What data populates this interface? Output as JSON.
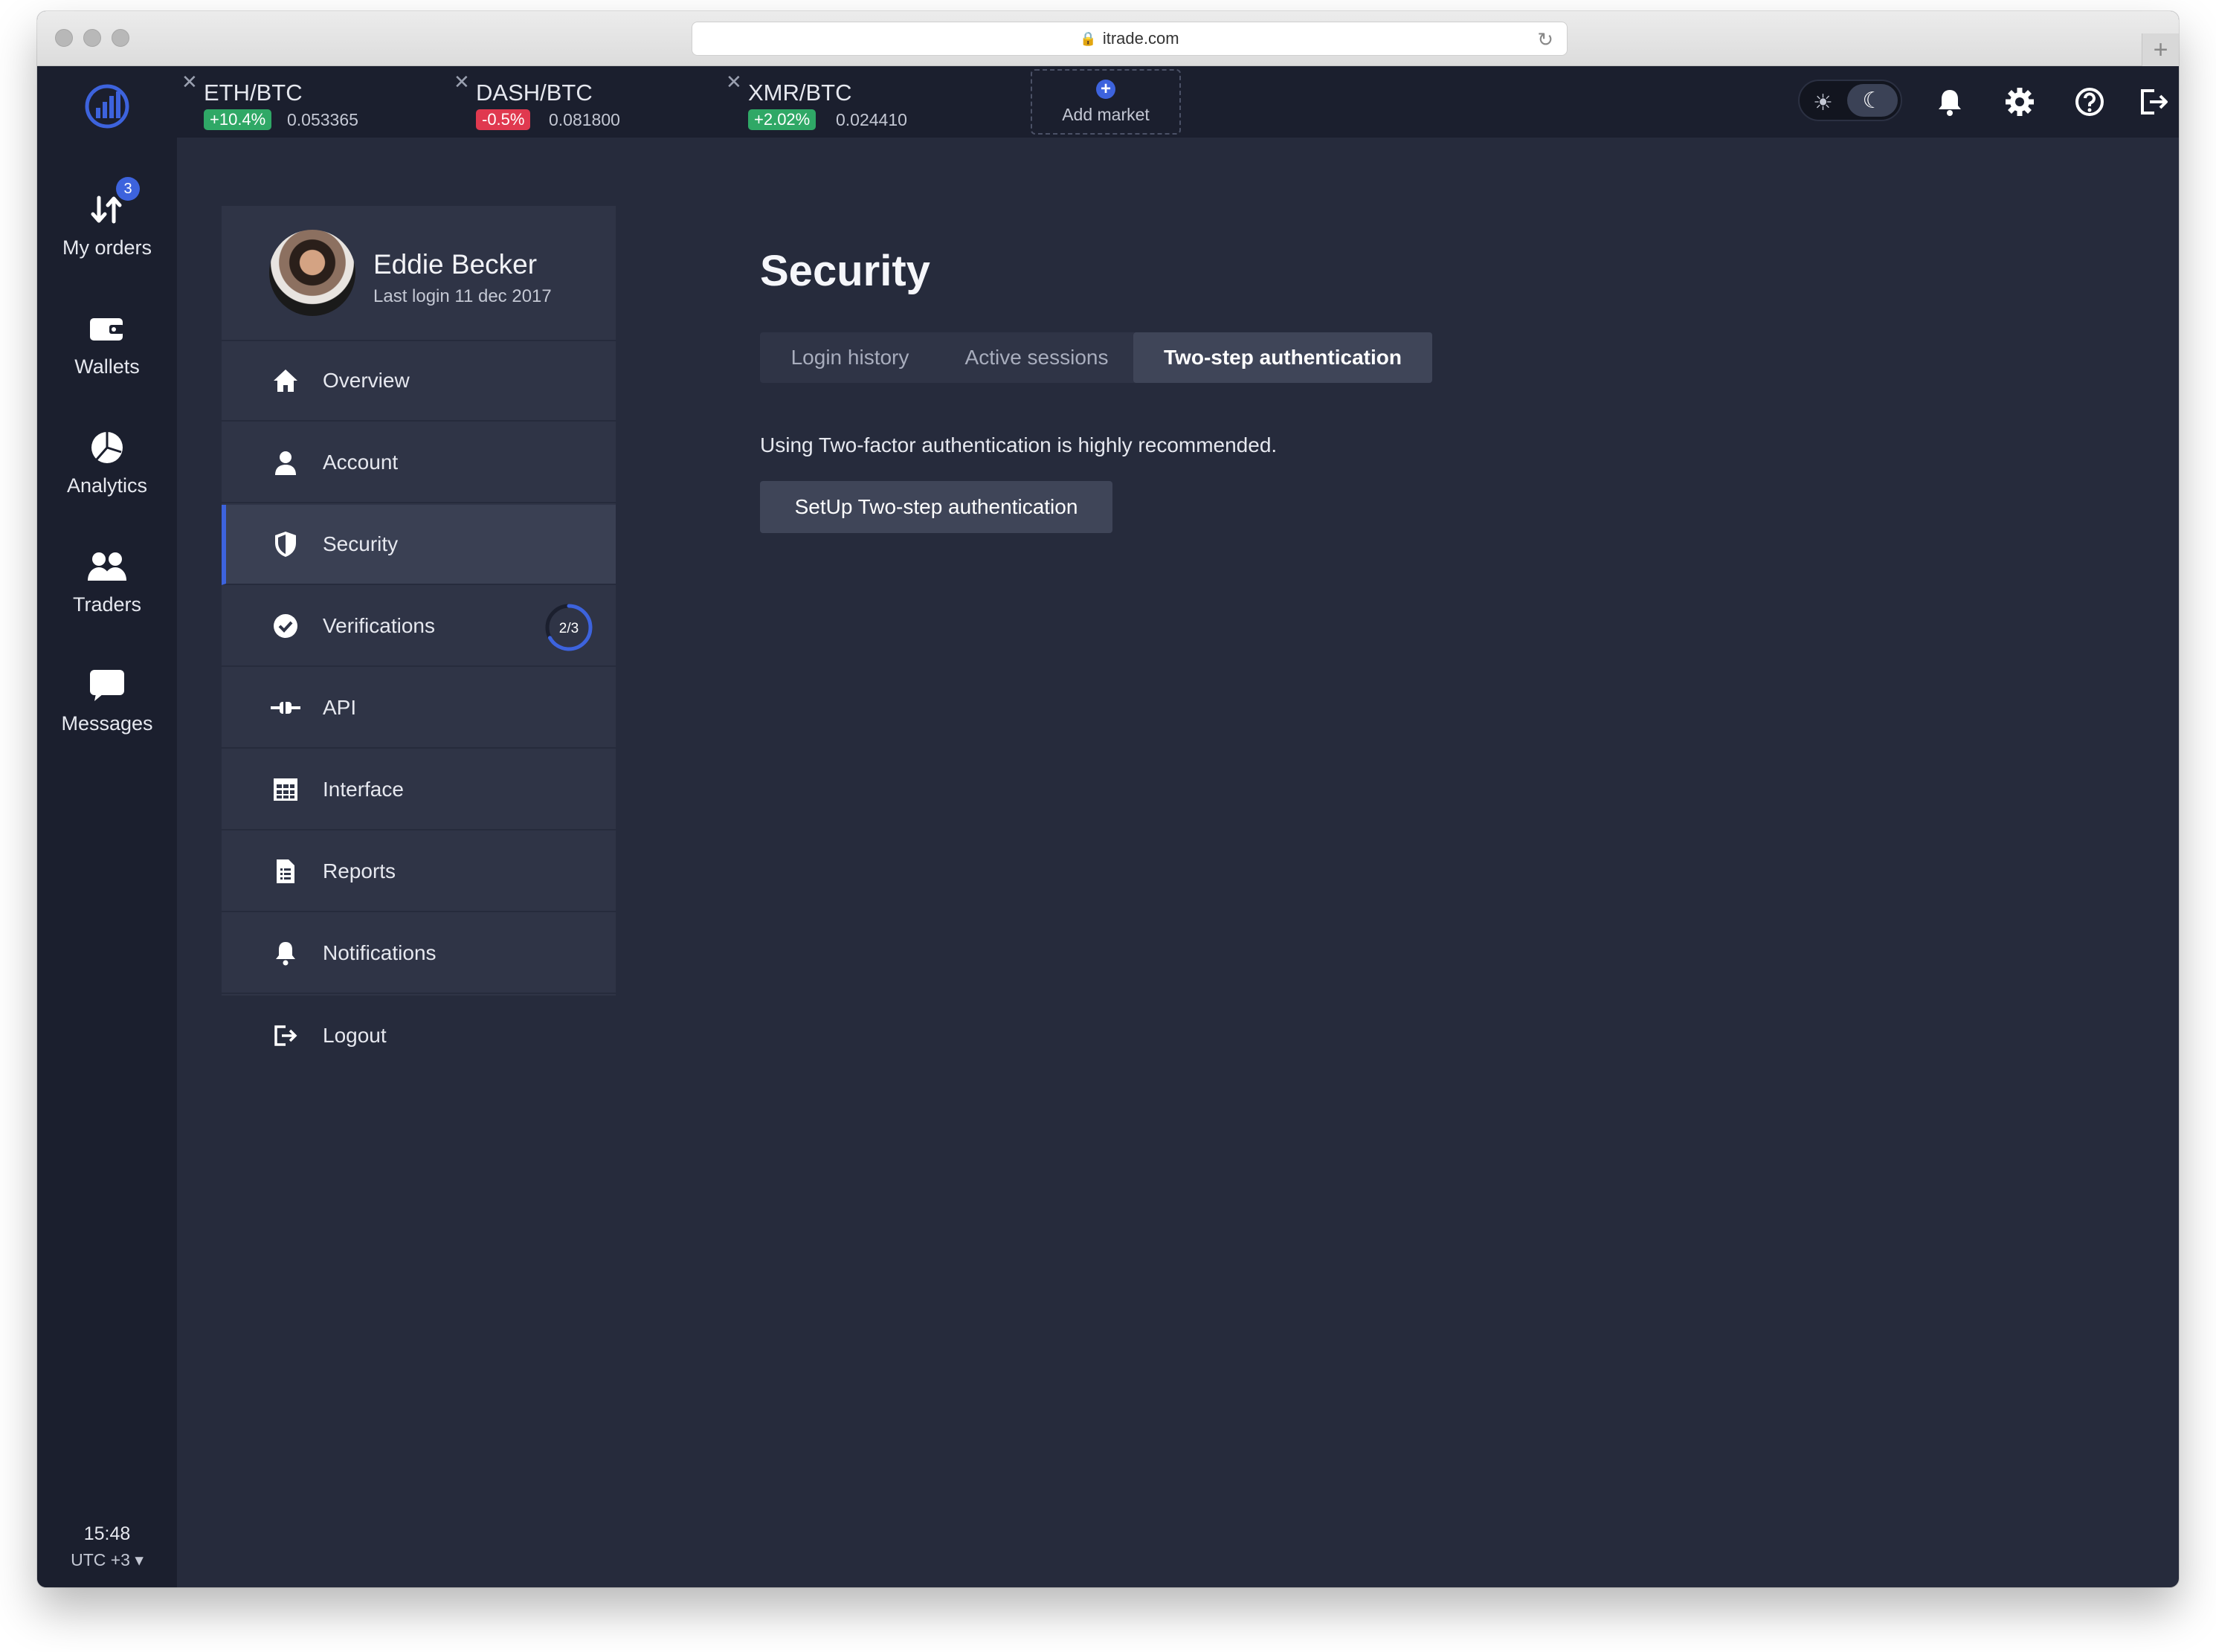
{
  "browser": {
    "url": "itrade.com"
  },
  "nav": {
    "orders_badge": "3",
    "items": [
      {
        "label": "My orders"
      },
      {
        "label": "Wallets"
      },
      {
        "label": "Analytics"
      },
      {
        "label": "Traders"
      },
      {
        "label": "Messages"
      }
    ],
    "time": "15:48",
    "timezone": "UTC +3 ▾"
  },
  "markets": [
    {
      "pair": "ETH/BTC",
      "change": "+10.4%",
      "price": "0.053365",
      "color": "#2fa866"
    },
    {
      "pair": "DASH/BTC",
      "change": "-0.5%",
      "price": "0.081800",
      "color": "#e0394f"
    },
    {
      "pair": "XMR/BTC",
      "change": "+2.02%",
      "price": "0.024410",
      "color": "#2fa866"
    }
  ],
  "add_market": "Add market",
  "profile": {
    "name": "Eddie Becker",
    "last_login": "Last login 11 dec 2017"
  },
  "menu": [
    {
      "label": "Overview",
      "icon": "home-icon"
    },
    {
      "label": "Account",
      "icon": "user-icon"
    },
    {
      "label": "Security",
      "icon": "shield-icon"
    },
    {
      "label": "Verifications",
      "icon": "check-badge-icon",
      "progress": "2/3",
      "progress_fraction": 0.67
    },
    {
      "label": "API",
      "icon": "plug-icon"
    },
    {
      "label": "Interface",
      "icon": "grid-icon"
    },
    {
      "label": "Reports",
      "icon": "document-icon"
    },
    {
      "label": "Notifications",
      "icon": "bell-icon"
    }
  ],
  "logout": "Logout",
  "page": {
    "title": "Security",
    "tabs": [
      "Login history",
      "Active sessions",
      "Two-step authentication"
    ],
    "active_tab": "Two-step authentication",
    "info_text": "Using Two-factor authentication is highly recommended.",
    "setup_button": "SetUp Two-step authentication"
  },
  "colors": {
    "accent": "#3d63dd",
    "background": "#262b3c",
    "sidebar": "#1b1f2e",
    "card": "#2f3446"
  }
}
